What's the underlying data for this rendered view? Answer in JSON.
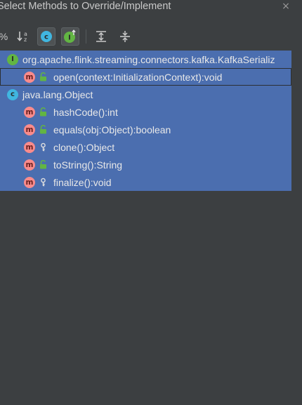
{
  "dialog": {
    "title": "Select Methods to Override/Implement",
    "close_glyph": "×"
  },
  "toolbar": {
    "buttons": [
      {
        "name": "show-percent-button",
        "glyph": "%",
        "active": false
      },
      {
        "name": "sort-alphabetically-icon",
        "glyph": "↓a z",
        "active": false
      },
      {
        "name": "show-classes-icon",
        "glyph": "c",
        "active": true
      },
      {
        "name": "show-interfaces-icon",
        "glyph": "I↑",
        "active": true
      },
      {
        "name": "expand-all-icon",
        "glyph": "expand",
        "active": false
      },
      {
        "name": "collapse-all-icon",
        "glyph": "collapse",
        "active": false
      }
    ]
  },
  "colors": {
    "selection": "#4b6eaf",
    "interface_badge": "#62b543",
    "class_badge": "#40b6e0",
    "method_badge": "#f98b8b",
    "background": "#3c3f41"
  },
  "tree": {
    "rows": [
      {
        "kind": "interface",
        "badge": "I",
        "access": "",
        "label": "org.apache.flink.streaming.connectors.kafka.KafkaSerializ"
      },
      {
        "kind": "method",
        "badge": "m",
        "access": "public",
        "label": "open(context:InitializationContext):void",
        "focused": true
      },
      {
        "kind": "class",
        "badge": "c",
        "access": "",
        "label": "java.lang.Object"
      },
      {
        "kind": "method",
        "badge": "m",
        "access": "public",
        "label": "hashCode():int"
      },
      {
        "kind": "method",
        "badge": "m",
        "access": "public",
        "label": "equals(obj:Object):boolean"
      },
      {
        "kind": "method",
        "badge": "m",
        "access": "protected",
        "label": "clone():Object"
      },
      {
        "kind": "method",
        "badge": "m",
        "access": "public",
        "label": "toString():String"
      },
      {
        "kind": "method",
        "badge": "m",
        "access": "protected",
        "label": "finalize():void"
      }
    ]
  }
}
